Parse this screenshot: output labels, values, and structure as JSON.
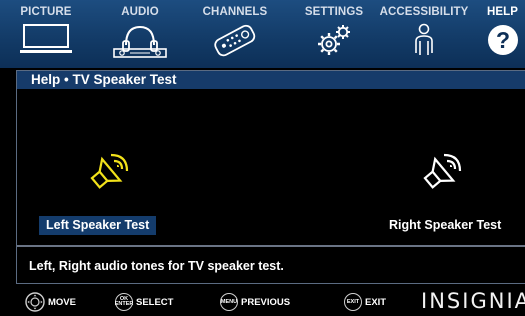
{
  "menu": {
    "tabs": [
      {
        "label": "PICTURE",
        "icon": "tv-icon",
        "active": false
      },
      {
        "label": "AUDIO",
        "icon": "headphones-icon",
        "active": false
      },
      {
        "label": "CHANNELS",
        "icon": "remote-control-icon",
        "active": false
      },
      {
        "label": "SETTINGS",
        "icon": "gears-icon",
        "active": false
      },
      {
        "label": "ACCESSIBILITY",
        "icon": "person-icon",
        "active": false
      },
      {
        "label": "HELP",
        "icon": "question-icon",
        "active": true
      }
    ]
  },
  "panel": {
    "title": "Help • TV Speaker Test",
    "left_speaker": {
      "label": "Left Speaker Test",
      "selected": true,
      "icon": "speaker-icon",
      "icon_color": "#f2e21a"
    },
    "right_speaker": {
      "label": "Right Speaker Test",
      "selected": false,
      "icon": "speaker-icon",
      "icon_color": "#ffffff"
    },
    "help_text": "Left, Right audio tones for TV speaker test."
  },
  "bottom_nav": {
    "items": [
      {
        "button": "",
        "label": "MOVE",
        "icon": "dpad-icon"
      },
      {
        "button": "OK ENTER",
        "label": "SELECT",
        "icon": "ok-enter-button-icon"
      },
      {
        "button": "MENU",
        "label": "PREVIOUS",
        "icon": "menu-button-icon"
      },
      {
        "button": "EXIT",
        "label": "EXIT",
        "icon": "exit-button-icon"
      }
    ],
    "brand": "INSIGNIA"
  },
  "colors": {
    "menu_bar": "#123a66",
    "title_bar": "#163b6a",
    "selected_highlight": "#143c6c",
    "active_speaker": "#f2e21a"
  }
}
